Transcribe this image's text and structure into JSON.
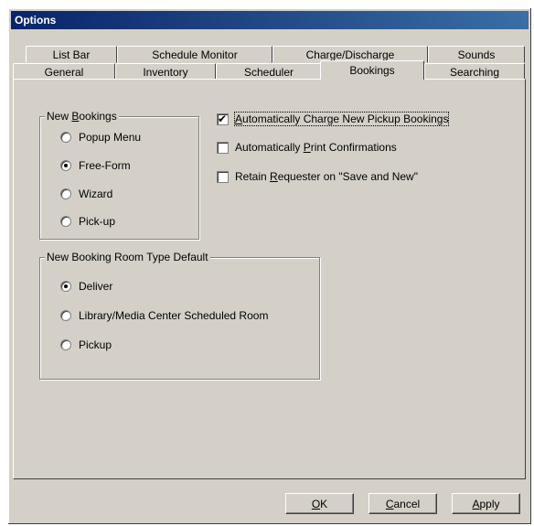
{
  "window": {
    "title": "Options"
  },
  "tabs_back": [
    "List Bar",
    "Schedule Monitor",
    "Charge/Discharge",
    "Sounds"
  ],
  "tabs_front": [
    "General",
    "Inventory",
    "Scheduler",
    "Bookings",
    "Searching"
  ],
  "active_tab": "Bookings",
  "new_bookings": {
    "title_pre": "New ",
    "title_accel": "B",
    "title_post": "ookings",
    "options": [
      "Popup Menu",
      "Free-Form",
      "Wizard",
      "Pick-up"
    ],
    "selected": "Free-Form"
  },
  "checks": [
    {
      "pre": "",
      "accel": "A",
      "post": "utomatically Charge New Pickup Bookings",
      "checked": true
    },
    {
      "pre": "Automatically ",
      "accel": "P",
      "post": "rint Confirmations",
      "checked": false
    },
    {
      "pre": "Retain ",
      "accel": "R",
      "post": "equester on \"Save and New\"",
      "checked": false
    }
  ],
  "room_type": {
    "title": "New Booking Room Type Default",
    "options": [
      "Deliver",
      "Library/Media Center Scheduled Room",
      "Pickup"
    ],
    "selected": "Deliver"
  },
  "buttons": {
    "ok_accel": "O",
    "ok_post": "K",
    "cancel_accel": "C",
    "cancel_post": "ancel",
    "apply_accel": "A",
    "apply_post": "pply"
  }
}
